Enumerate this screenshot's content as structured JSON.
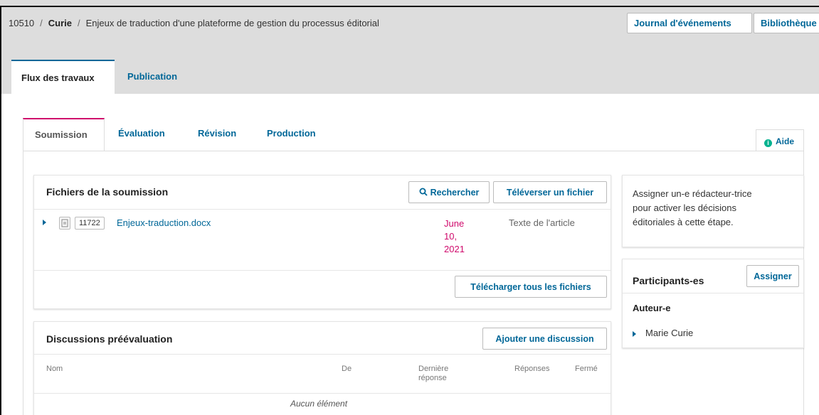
{
  "header": {
    "submission_id": "10510",
    "author": "Curie",
    "title": "Enjeux de traduction d'une plateforme de gestion du processus éditorial",
    "event_log_label": "Journal d'événements",
    "library_label": "Bibliothèque"
  },
  "main_tabs": [
    {
      "label": "Flux des travaux",
      "active": true
    },
    {
      "label": "Publication",
      "active": false
    }
  ],
  "stage_tabs": [
    {
      "label": "Soumission",
      "active": true
    },
    {
      "label": "Évaluation",
      "active": false
    },
    {
      "label": "Révision",
      "active": false
    },
    {
      "label": "Production",
      "active": false
    }
  ],
  "help_label": "Aide",
  "files_panel": {
    "title": "Fichiers de la soumission",
    "search_label": "Rechercher",
    "upload_label": "Téléverser un fichier",
    "files": [
      {
        "id": "11722",
        "name": "Enjeux-traduction.docx",
        "date_lines": [
          "June",
          "10,",
          "2021"
        ],
        "type": "Texte de l'article"
      }
    ],
    "download_all_label": "Télécharger tous les fichiers"
  },
  "discussions_panel": {
    "title": "Discussions préévaluation",
    "add_label": "Ajouter une discussion",
    "columns": [
      "Nom",
      "De",
      "Dernière",
      "réponse",
      "Réponses",
      "Fermé"
    ],
    "empty_label": "Aucun élément"
  },
  "sidebar": {
    "assign_notice_lines": [
      "Assigner un-e rédacteur-trice",
      "pour activer les décisions",
      "éditoriales à cette étape."
    ],
    "participants_title": "Participants-es",
    "assign_label": "Assigner",
    "role_label": "Auteur-e",
    "participants": [
      "Marie Curie"
    ]
  },
  "colors": {
    "accent": "#006798",
    "active_stage": "#d00a6c",
    "help_icon": "#00b28f"
  },
  "icons": [
    "search-icon",
    "info-icon",
    "expand-triangle-icon",
    "document-icon"
  ]
}
